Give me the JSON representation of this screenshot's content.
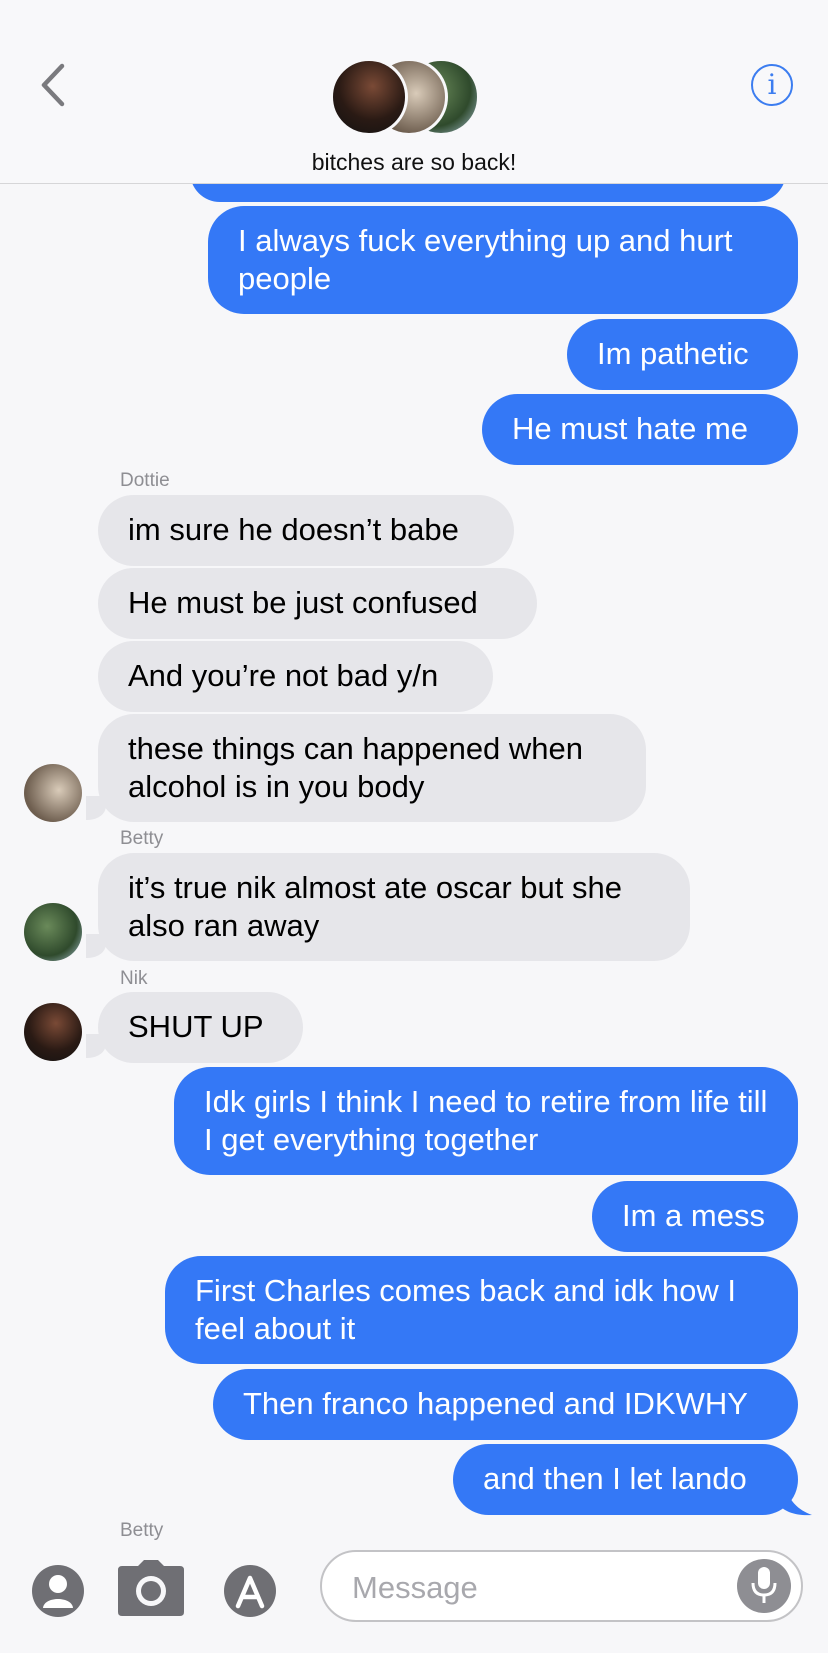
{
  "header": {
    "title": "bitches are so back!"
  },
  "messages": [
    {
      "text": "I always fuck everything up and hurt people"
    },
    {
      "text": "Im pathetic"
    },
    {
      "text": "He must hate me"
    },
    {
      "sender": "Dottie"
    },
    {
      "text": "im sure he doesn’t babe"
    },
    {
      "text": "He must be just confused"
    },
    {
      "text": "And you’re not bad y/n"
    },
    {
      "text": "these things can happened when alcohol is in you body"
    },
    {
      "sender": "Betty"
    },
    {
      "text": "it’s true nik almost ate oscar but she also ran away"
    },
    {
      "sender": "Nik"
    },
    {
      "text": "SHUT UP"
    },
    {
      "text": "Idk girls I think I need to retire from life till I get everything together"
    },
    {
      "text": "Im a mess"
    },
    {
      "text": "First Charles comes back and idk how I feel about it"
    },
    {
      "text": "Then franco happened and IDKWHY"
    },
    {
      "text": "and then I let lando"
    },
    {
      "sender": "Betty"
    }
  ],
  "input": {
    "placeholder": "Message"
  },
  "colors": {
    "outgoing": "#3478f6",
    "incoming": "#e6e6ea",
    "accent": "#3c7df0"
  },
  "icons": [
    "back-chevron-icon",
    "info-icon",
    "contact-icon",
    "camera-icon",
    "app-store-icon",
    "microphone-icon"
  ]
}
